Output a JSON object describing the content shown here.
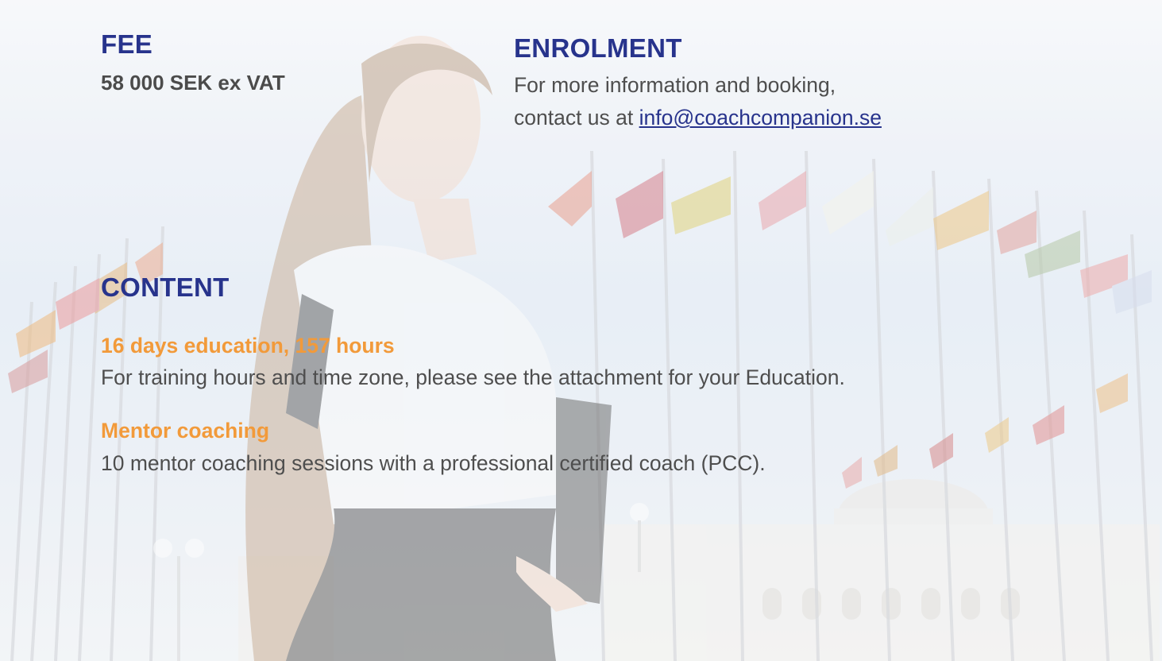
{
  "fee": {
    "heading": "FEE",
    "value": "58 000 SEK ex VAT"
  },
  "enrolment": {
    "heading": "ENROLMENT",
    "line1": "For more information and booking,",
    "line2_prefix": "contact us at ",
    "email": "info@coachcompanion.se"
  },
  "content": {
    "heading": "CONTENT",
    "items": [
      {
        "title": "16 days education, 157 hours",
        "description": "For training hours and time zone, please see the attachment for your Education."
      },
      {
        "title": "Mentor coaching",
        "description": "10 mentor coaching sessions with a professional certified coach (PCC)."
      }
    ]
  },
  "colors": {
    "heading": "#27338c",
    "accent": "#f29a3a",
    "body_text": "#4e4e4e"
  }
}
